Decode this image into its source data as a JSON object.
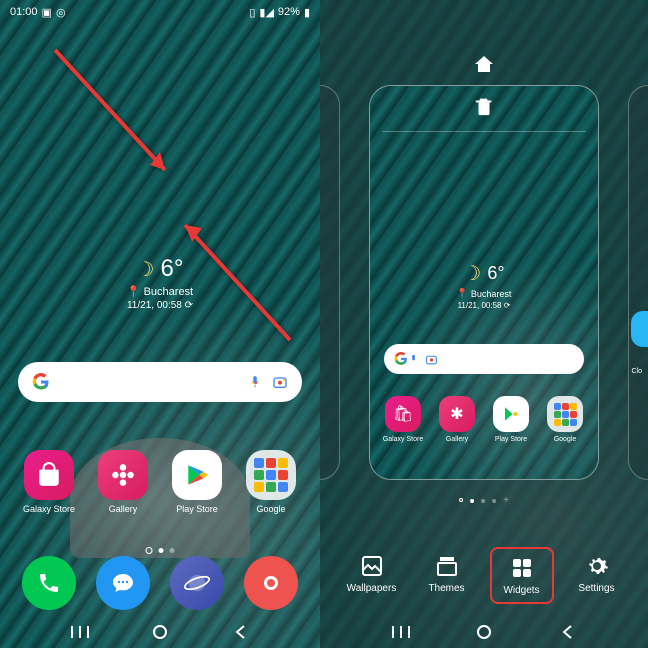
{
  "status": {
    "time": "01:00",
    "battery": "92%"
  },
  "weather": {
    "temp": "6°",
    "location": "Bucharest",
    "datetime": "11/21, 00:58"
  },
  "apps": {
    "galaxy_store": "Galaxy Store",
    "gallery": "Gallery",
    "play_store": "Play Store",
    "google": "Google",
    "clock_partial": "Clo"
  },
  "tools": {
    "wallpapers": "Wallpapers",
    "themes": "Themes",
    "widgets": "Widgets",
    "settings": "Settings"
  },
  "colors": {
    "arrow": "#e53935",
    "highlight": "#e53935"
  }
}
